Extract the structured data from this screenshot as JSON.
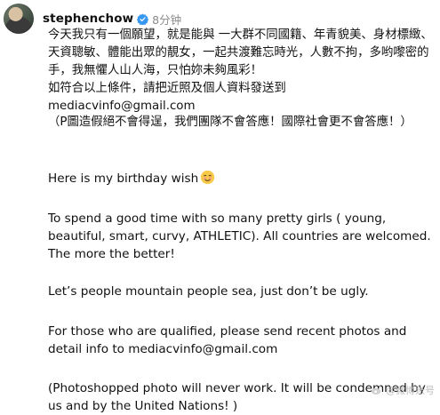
{
  "post": {
    "username": "stephenchow",
    "time": "8分钟",
    "paragraphs": {
      "p1": "今天我只有一個願望，就是能與 一大群不同國籍、年青貌美、身材標緻、天資聰敏、體能出眾的靚女，一起共渡難忘時光，人數不拘，多哟嚟密的手，我無懼人山人海，只怕妳未夠風彩！",
      "p2": "如符合以上條件，請把近照及個人資料發送到 mediacvinfo@gmail.com",
      "p3": "（P圖造假絕不會得逞，我們團隊不會答應！國際社會更不會答應！）",
      "p4": "Here is my birthday wish",
      "p5": "To spend a good time with so many pretty girls ( young, beautiful, smart, curvy, ATHLETIC). All countries are welcomed. The more the better!",
      "p6": "Let’s people mountain people sea, just don’t be ugly.",
      "p7": "For those who are qualified, please send recent photos and detail info to mediacvinfo@gmail.com",
      "p8": "(Photoshopped photo will never work. It will be condemned by us and by the United Nations! )"
    },
    "emoji": "smiling-face-emoji",
    "colors": {
      "verified": "#3897f0",
      "time": "#8a8a8a"
    }
  },
  "watermark": {
    "text": "@微博账号"
  }
}
